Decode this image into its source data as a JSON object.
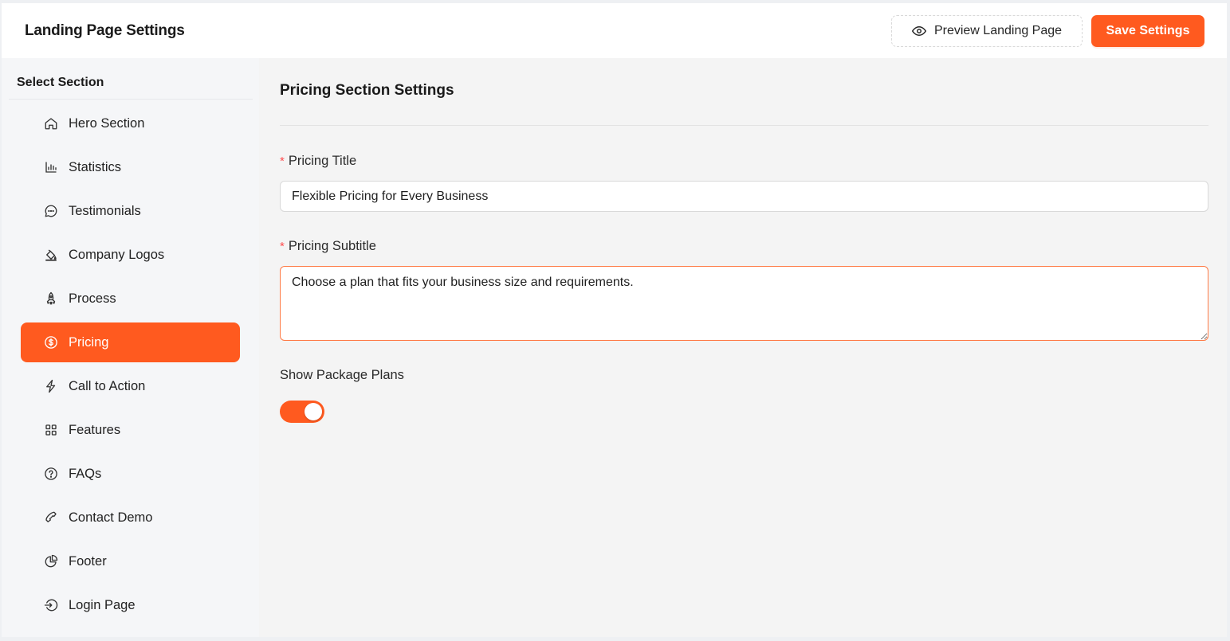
{
  "header": {
    "title": "Landing Page Settings",
    "preview_label": "Preview Landing Page",
    "save_label": "Save Settings"
  },
  "sidebar": {
    "heading": "Select Section",
    "items": [
      {
        "label": "Hero Section",
        "icon": "home-icon"
      },
      {
        "label": "Statistics",
        "icon": "bar-chart-icon"
      },
      {
        "label": "Testimonials",
        "icon": "chat-icon"
      },
      {
        "label": "Company Logos",
        "icon": "paint-bucket-icon"
      },
      {
        "label": "Process",
        "icon": "rocket-icon"
      },
      {
        "label": "Pricing",
        "icon": "dollar-circle-icon",
        "active": true
      },
      {
        "label": "Call to Action",
        "icon": "lightning-icon"
      },
      {
        "label": "Features",
        "icon": "grid-icon"
      },
      {
        "label": "FAQs",
        "icon": "question-circle-icon"
      },
      {
        "label": "Contact Demo",
        "icon": "phone-icon"
      },
      {
        "label": "Footer",
        "icon": "pie-chart-icon"
      },
      {
        "label": "Login Page",
        "icon": "login-icon"
      }
    ]
  },
  "main": {
    "section_title": "Pricing Section Settings",
    "pricing_title": {
      "required_mark": "*",
      "label": "Pricing Title",
      "value": "Flexible Pricing for Every Business"
    },
    "pricing_subtitle": {
      "required_mark": "*",
      "label": "Pricing Subtitle",
      "value": "Choose a plan that fits your business size and requirements."
    },
    "show_package_plans": {
      "label": "Show Package Plans",
      "enabled": true
    }
  },
  "colors": {
    "accent": "#ff5a1f",
    "required": "#ff4d4f",
    "active_input_border": "#ff7a45"
  }
}
